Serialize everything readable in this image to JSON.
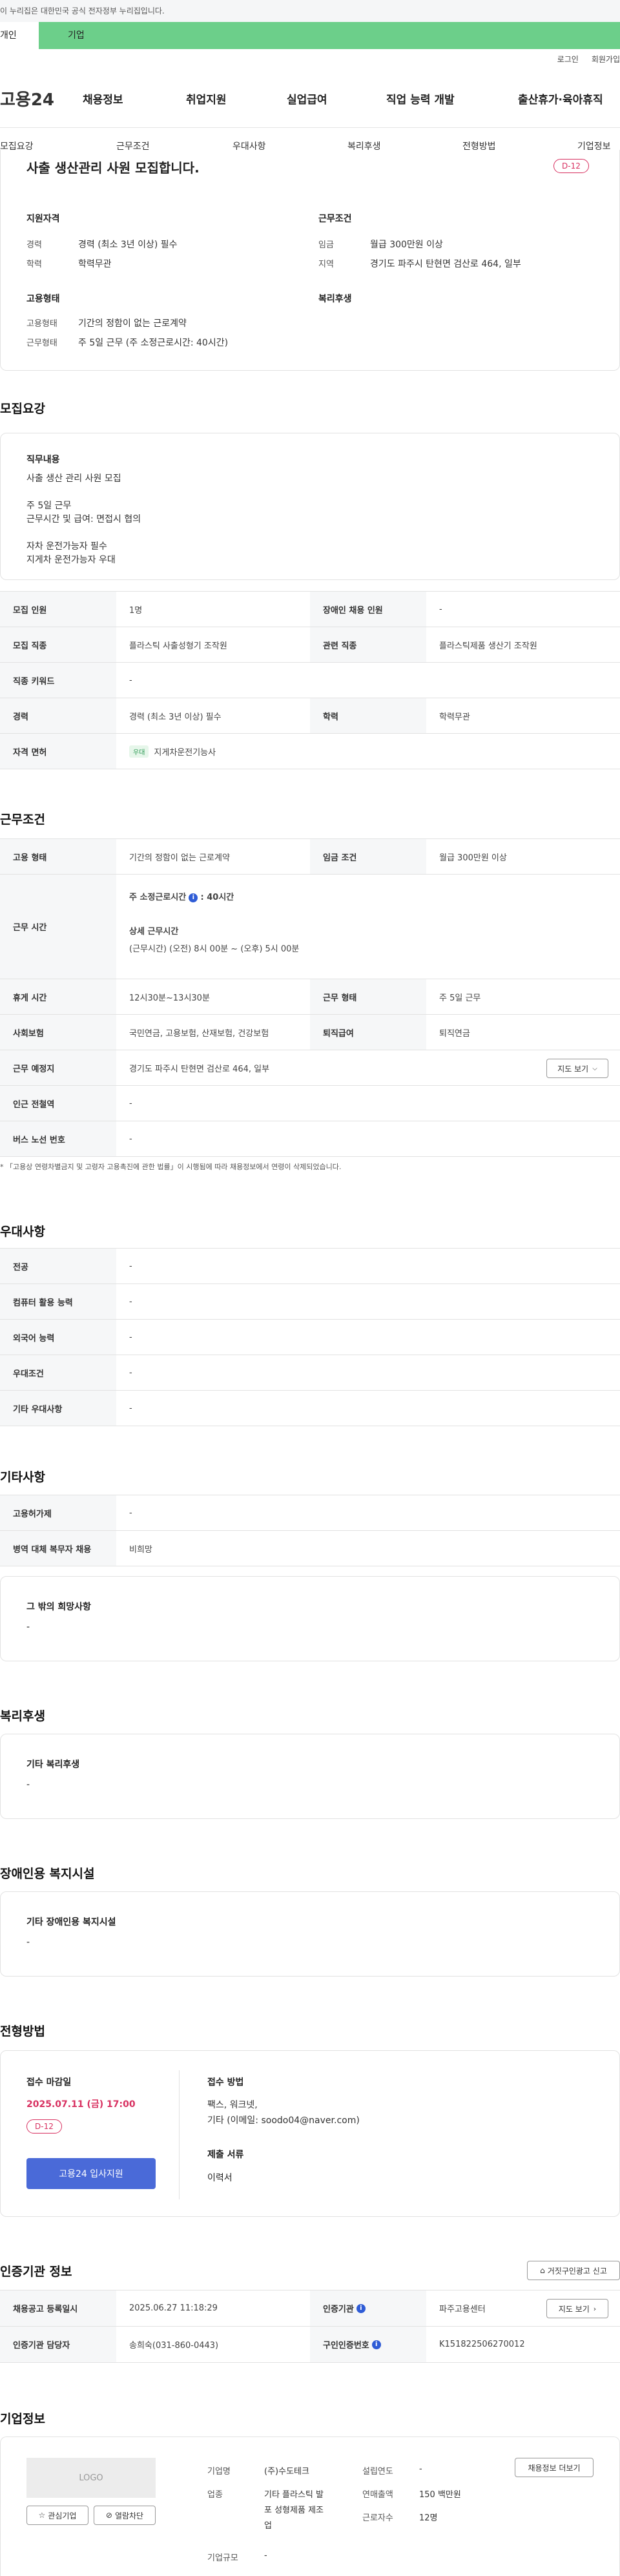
{
  "gov_banner": "이 누리집은 대한민국 공식 전자정부 누리집입니다.",
  "tabs": {
    "personal": "개인",
    "company": "기업"
  },
  "util": {
    "login": "로그인",
    "join": "회원가입"
  },
  "logo": "고용24",
  "gnb": [
    "채용정보",
    "취업지원",
    "실업급여",
    "직업 능력 개발",
    "출산휴가·육아휴직"
  ],
  "subnav": [
    "모집요강",
    "근무조건",
    "우대사항",
    "복리후생",
    "전형방법",
    "기업정보"
  ],
  "summary": {
    "title": "사출 생산관리 사원 모집합니다.",
    "dday": "D-12",
    "qual_head": "지원자격",
    "career_label": "경력",
    "career_value": "경력 (최소 3년 이상) 필수",
    "edu_label": "학력",
    "edu_value": "학력무관",
    "cond_head": "근무조건",
    "wage_label": "임금",
    "wage_value": "월급 300만원 이상",
    "region_label": "지역",
    "region_value": "경기도 파주시 탄현면 검산로 464, 일부",
    "emp_head": "고용형태",
    "emptype_label": "고용형태",
    "emptype_value": "기간의 정함이 없는 근로계약",
    "worktype_label": "근무형태",
    "worktype_value": "주 5일 근무 (주 소정근로시간: 40시간)",
    "welfare_head": "복리후생"
  },
  "recruit": {
    "title": "모집요강",
    "duty_head": "직무내용",
    "duty_lines": [
      "사출 생산 관리 사원 모집",
      "",
      "주 5일 근무",
      "근무시간 및 급여: 면접시 협의",
      "",
      "자차 운전가능자 필수",
      "지게차 운전가능자 우대"
    ],
    "rows": [
      {
        "th1": "모집 인원",
        "td1": "1명",
        "th2": "장애인 채용 인원",
        "td2": "-"
      },
      {
        "th1": "모집 직종",
        "td1": "플라스틱 사출성형기 조작원",
        "th2": "관련 직종",
        "td2": "플라스틱제품 생산기 조작원"
      },
      {
        "th1": "직종 키워드",
        "td1": "-"
      },
      {
        "th1": "경력",
        "td1": "경력 (최소 3년 이상) 필수",
        "th2": "학력",
        "td2": "학력무관"
      },
      {
        "th1": "자격 면허",
        "td1_tag": "우대",
        "td1": "지게차운전기능사"
      }
    ]
  },
  "work": {
    "title": "근무조건",
    "emp_th": "고용 형태",
    "emp_td": "기간의 정함이 없는 근로계약",
    "wage_th": "임금 조건",
    "wage_td": "월급 300만원 이상",
    "time_th": "근무 시간",
    "time_main_label": "주 소정근로시간",
    "time_main_value": ": 40시간",
    "time_detail_label": "상세 근무시간",
    "time_detail_value": "(근무시간) (오전) 8시 00분 ~ (오후) 5시 00분",
    "rest_th": "휴게 시간",
    "rest_td": "12시30분~13시30분",
    "worktype_th": "근무 형태",
    "worktype_td": "주 5일 근무",
    "ins_th": "사회보험",
    "ins_td": "국민연금, 고용보험, 산재보험, 건강보험",
    "retire_th": "퇴직급여",
    "retire_td": "퇴직연금",
    "place_th": "근무 예정지",
    "place_td": "경기도 파주시 탄현면 검산로 464, 일부",
    "map_btn": "지도 보기",
    "station_th": "인근 전철역",
    "station_td": "-",
    "bus_th": "버스 노선 번호",
    "bus_td": "-",
    "note": "* 「고용상 연령차별금지 및 고령자 고용촉진에 관한 법률」이 시행됨에 따라 채용정보에서 연령이 삭제되었습니다."
  },
  "pref": {
    "title": "우대사항",
    "rows": [
      {
        "th": "전공",
        "td": "-"
      },
      {
        "th": "컴퓨터 활용 능력",
        "td": "-"
      },
      {
        "th": "외국어 능력",
        "td": "-"
      },
      {
        "th": "우대조건",
        "td": "-"
      },
      {
        "th": "기타 우대사항",
        "td": "-"
      }
    ]
  },
  "etc": {
    "title": "기타사항",
    "rows": [
      {
        "th": "고용허가제",
        "td": "-"
      },
      {
        "th": "병역 대체 복무자 채용",
        "td": "비희망"
      }
    ],
    "other_head": "그 밖의 희망사항",
    "other_value": "-"
  },
  "welfare": {
    "title": "복리후생",
    "head": "기타 복리후생",
    "value": "-"
  },
  "disabled": {
    "title": "장애인용 복지시설",
    "head": "기타 장애인용 복지시설",
    "value": "-"
  },
  "selection": {
    "title": "전형방법",
    "deadline_head": "접수 마감일",
    "deadline": "2025.07.11 (금) 17:00",
    "dday": "D-12",
    "apply_btn": "고용24 입사지원",
    "method_head": "접수 방법",
    "method_lines": [
      "팩스, 워크넷,",
      "기타 (이메일: soodo04@naver.com)"
    ],
    "docs_head": "제출 서류",
    "docs_value": "이력서"
  },
  "agency": {
    "title": "인증기관 정보",
    "report_btn": "거짓구인광고 신고",
    "date_th": "채용공고 등록일시",
    "date_td": "2025.06.27 11:18:29",
    "org_th": "인증기관",
    "org_td": "파주고용센터",
    "map_btn": "지도 보기",
    "mgr_th": "인증기관 담당자",
    "mgr_td": "송희숙(031-860-0443)",
    "no_th": "구인인증번호",
    "no_td": "K151822506270012"
  },
  "company": {
    "title": "기업정보",
    "logo": "LOGO",
    "fav_btn": "관심기업",
    "block_btn": "열람차단",
    "name_label": "기업명",
    "name_value": "(주)수도테크",
    "ind_label": "업종",
    "ind_value": [
      "기타 플라스틱 발",
      "포 성형제품 제조",
      "업"
    ],
    "scale_label": "기업규모",
    "scale_value": "-",
    "year_label": "설립연도",
    "year_value": "-",
    "sales_label": "연매출액",
    "sales_value": "150 백만원",
    "emp_label": "근로자수",
    "emp_value": "12명",
    "jobs_btn": "채용정보 더보기"
  },
  "colors": {
    "accent_green": "#6ccf8a",
    "dday_red": "#d83060",
    "apply_blue": "#4a6ad8"
  }
}
